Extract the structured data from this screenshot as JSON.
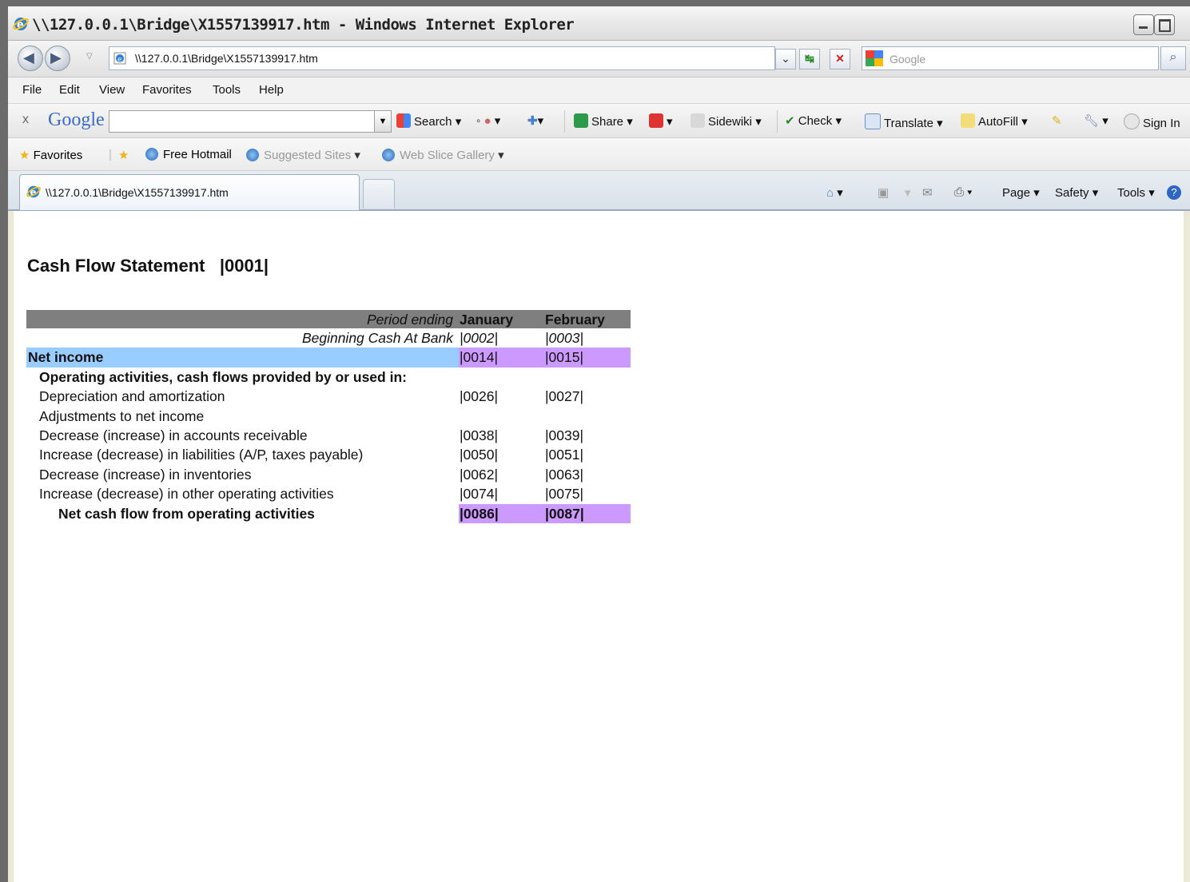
{
  "window": {
    "title": "\\\\127.0.0.1\\Bridge\\X1557139917.htm - Windows Internet Explorer"
  },
  "address": {
    "url": "\\\\127.0.0.1\\Bridge\\X1557139917.htm",
    "search_placeholder": "Google"
  },
  "menu": [
    "File",
    "Edit",
    "View",
    "Favorites",
    "Tools",
    "Help"
  ],
  "google_toolbar": {
    "close": "x",
    "logo": "Google",
    "search": "Search",
    "share": "Share",
    "sidewiki": "Sidewiki",
    "check": "Check",
    "translate": "Translate",
    "autofill": "AutoFill",
    "sign_in": "Sign In"
  },
  "favorites_bar": {
    "favorites": "Favorites",
    "free_hotmail": "Free Hotmail",
    "suggested_sites": "Suggested Sites",
    "web_slice_gallery": "Web Slice Gallery"
  },
  "tab": {
    "label": "\\\\127.0.0.1\\Bridge\\X1557139917.htm"
  },
  "commands": {
    "page": "Page",
    "safety": "Safety",
    "tools": "Tools"
  },
  "report": {
    "title": "Cash Flow Statement   |0001|",
    "header": {
      "label": "Period ending",
      "jan": "January",
      "feb": "February"
    },
    "beginning_cash": {
      "label": "Beginning Cash At Bank",
      "jan": "|0002|",
      "feb": "|0003|"
    },
    "net_income": {
      "label": "Net income",
      "jan": "|0014|",
      "feb": "|0015|"
    },
    "operating_heading": "Operating activities, cash flows provided by or used in:",
    "rows": [
      {
        "label": "Depreciation and amortization",
        "jan": "|0026|",
        "feb": "|0027|"
      },
      {
        "label": "Adjustments to net income",
        "jan": "",
        "feb": ""
      },
      {
        "label": "Decrease (increase) in accounts receivable",
        "jan": "|0038|",
        "feb": "|0039|"
      },
      {
        "label": "Increase (decrease) in liabilities (A/P, taxes payable)",
        "jan": "|0050|",
        "feb": "|0051|"
      },
      {
        "label": "Decrease (increase) in inventories",
        "jan": "|0062|",
        "feb": "|0063|"
      },
      {
        "label": "Increase (decrease) in other operating activities",
        "jan": "|0074|",
        "feb": "|0075|"
      }
    ],
    "net_cash_operating": {
      "label": "Net cash flow from operating activities",
      "jan": "|0086|",
      "feb": "|0087|"
    }
  }
}
